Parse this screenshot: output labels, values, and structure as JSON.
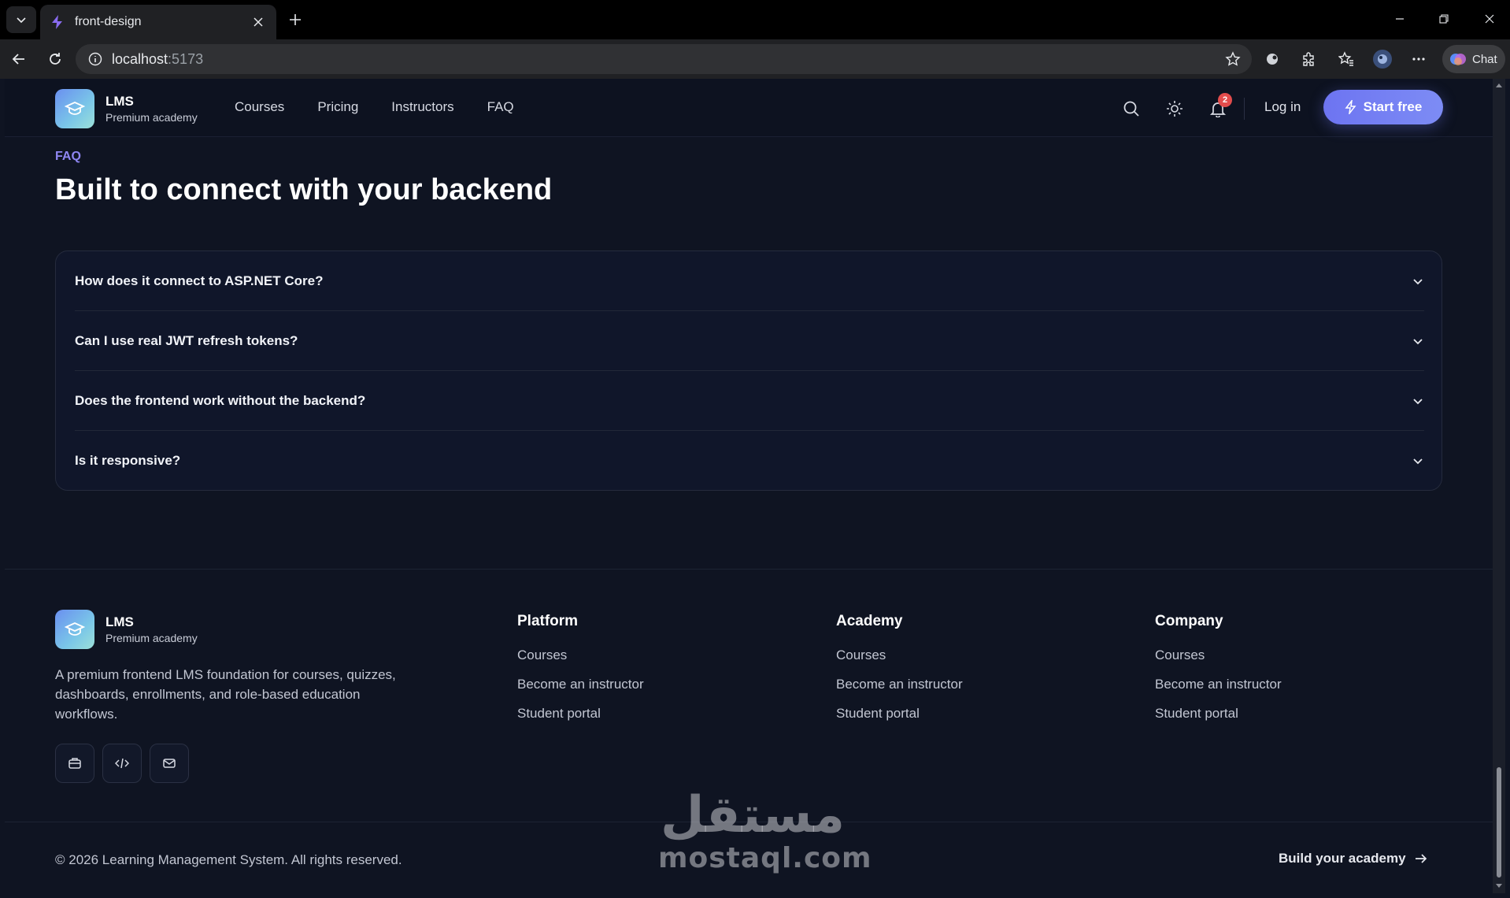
{
  "browser": {
    "tab_title": "front-design",
    "url_host": "localhost",
    "url_port": ":5173",
    "chat_label": "Chat"
  },
  "header": {
    "brand_name": "LMS",
    "brand_tagline": "Premium academy",
    "nav": [
      "Courses",
      "Pricing",
      "Instructors",
      "FAQ"
    ],
    "notification_count": "2",
    "login_label": "Log in",
    "cta_label": "Start free"
  },
  "faq": {
    "eyebrow": "FAQ",
    "title": "Built to connect with your backend",
    "items": [
      "How does it connect to ASP.NET Core?",
      "Can I use real JWT refresh tokens?",
      "Does the frontend work without the backend?",
      "Is it responsive?"
    ]
  },
  "footer": {
    "brand_name": "LMS",
    "brand_tagline": "Premium academy",
    "description": "A premium frontend LMS foundation for courses, quizzes, dashboards, enrollments, and role-based education workflows.",
    "social_icons": [
      "briefcase-icon",
      "code-icon",
      "mail-icon"
    ],
    "columns": [
      {
        "title": "Platform",
        "links": [
          "Courses",
          "Become an instructor",
          "Student portal"
        ]
      },
      {
        "title": "Academy",
        "links": [
          "Courses",
          "Become an instructor",
          "Student portal"
        ]
      },
      {
        "title": "Company",
        "links": [
          "Courses",
          "Become an instructor",
          "Student portal"
        ]
      }
    ],
    "copyright": "© 2026 Learning Management System. All rights reserved.",
    "build_link": "Build your academy"
  },
  "watermark": {
    "arabic": "مستقل",
    "latin": "mostaql.com"
  },
  "colors": {
    "background": "#0f1422",
    "accent": "#8f86f2",
    "cta_start": "#6d74f1",
    "badge": "#e24c4c"
  }
}
